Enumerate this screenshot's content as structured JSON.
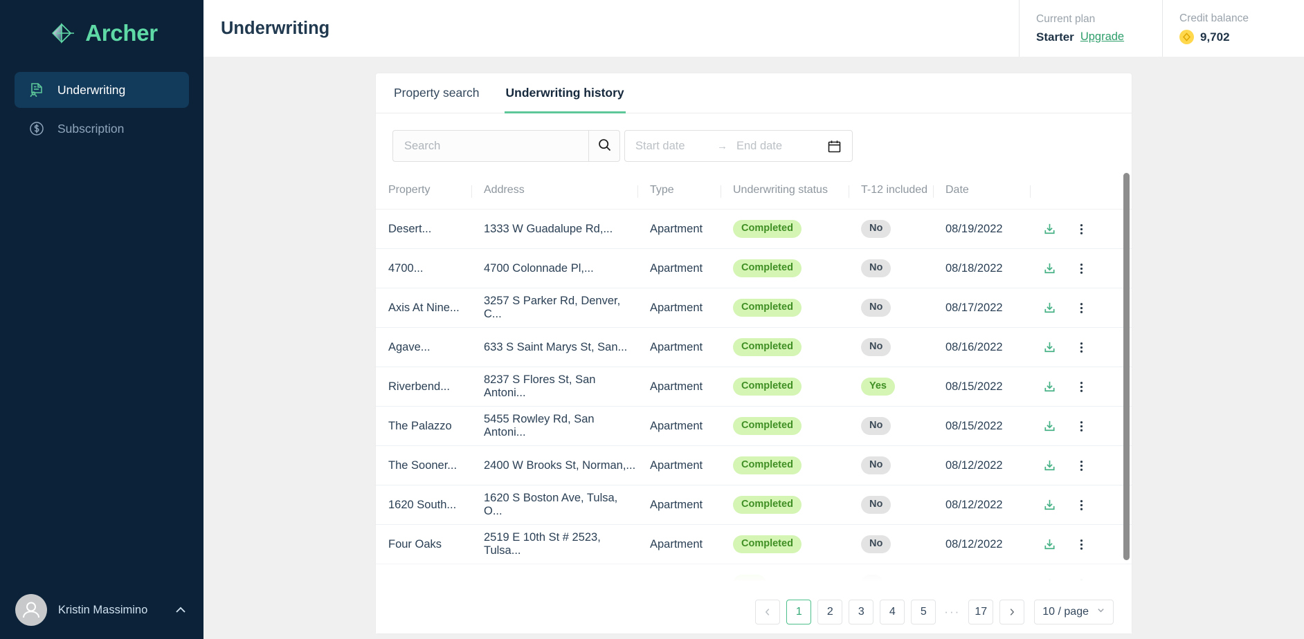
{
  "brand": {
    "name": "Archer",
    "logo_icon": "archer-diamond-logo"
  },
  "sidebar": {
    "items": [
      {
        "label": "Underwriting",
        "icon": "document-person-icon",
        "active": true
      },
      {
        "label": "Subscription",
        "icon": "dollar-circle-icon",
        "active": false
      }
    ],
    "user": {
      "name": "Kristin Massimino",
      "avatar_icon": "user-avatar-icon",
      "chevron_icon": "chevron-up-icon"
    }
  },
  "header": {
    "title": "Underwriting",
    "plan": {
      "label": "Current plan",
      "value": "Starter",
      "upgrade_label": "Upgrade"
    },
    "credit": {
      "label": "Credit balance",
      "value": "9,702",
      "coin_icon": "credit-coin-icon"
    }
  },
  "tabs": [
    {
      "label": "Property search",
      "active": false
    },
    {
      "label": "Underwriting history",
      "active": true
    }
  ],
  "filters": {
    "search": {
      "placeholder": "Search",
      "value": "",
      "icon": "search-icon"
    },
    "date_range": {
      "start_placeholder": "Start date",
      "end_placeholder": "End date",
      "separator": "→",
      "icon": "calendar-icon"
    }
  },
  "table": {
    "columns": [
      "Property",
      "Address",
      "Type",
      "Underwriting status",
      "T-12 included",
      "Date",
      ""
    ],
    "rows": [
      {
        "property": "Desert...",
        "address": "1333 W Guadalupe Rd,...",
        "type": "Apartment",
        "status": "Completed",
        "t12": "No",
        "date": "08/19/2022"
      },
      {
        "property": "4700...",
        "address": "4700 Colonnade Pl,...",
        "type": "Apartment",
        "status": "Completed",
        "t12": "No",
        "date": "08/18/2022"
      },
      {
        "property": "Axis At Nine...",
        "address": "3257 S Parker Rd, Denver, C...",
        "type": "Apartment",
        "status": "Completed",
        "t12": "No",
        "date": "08/17/2022"
      },
      {
        "property": "Agave...",
        "address": "633 S Saint Marys St, San...",
        "type": "Apartment",
        "status": "Completed",
        "t12": "No",
        "date": "08/16/2022"
      },
      {
        "property": "Riverbend...",
        "address": "8237 S Flores St, San Antoni...",
        "type": "Apartment",
        "status": "Completed",
        "t12": "Yes",
        "date": "08/15/2022"
      },
      {
        "property": "The Palazzo",
        "address": "5455 Rowley Rd, San Antoni...",
        "type": "Apartment",
        "status": "Completed",
        "t12": "No",
        "date": "08/15/2022"
      },
      {
        "property": "The Sooner...",
        "address": "2400 W Brooks St, Norman,...",
        "type": "Apartment",
        "status": "Completed",
        "t12": "No",
        "date": "08/12/2022"
      },
      {
        "property": "1620 South...",
        "address": "1620 S Boston Ave, Tulsa, O...",
        "type": "Apartment",
        "status": "Completed",
        "t12": "No",
        "date": "08/12/2022"
      },
      {
        "property": "Four Oaks",
        "address": "2519 E 10th St # 2523, Tulsa...",
        "type": "Apartment",
        "status": "Completed",
        "t12": "No",
        "date": "08/12/2022"
      }
    ],
    "row_actions": {
      "download_icon": "download-icon",
      "menu_icon": "more-vertical-icon"
    }
  },
  "pagination": {
    "prev_icon": "chevron-left-icon",
    "next_icon": "chevron-right-icon",
    "pages": [
      "1",
      "2",
      "3",
      "4",
      "5"
    ],
    "ellipsis": "···",
    "last_page": "17",
    "current": "1",
    "page_size_label": "10 / page",
    "page_size_icon": "chevron-down-icon"
  }
}
